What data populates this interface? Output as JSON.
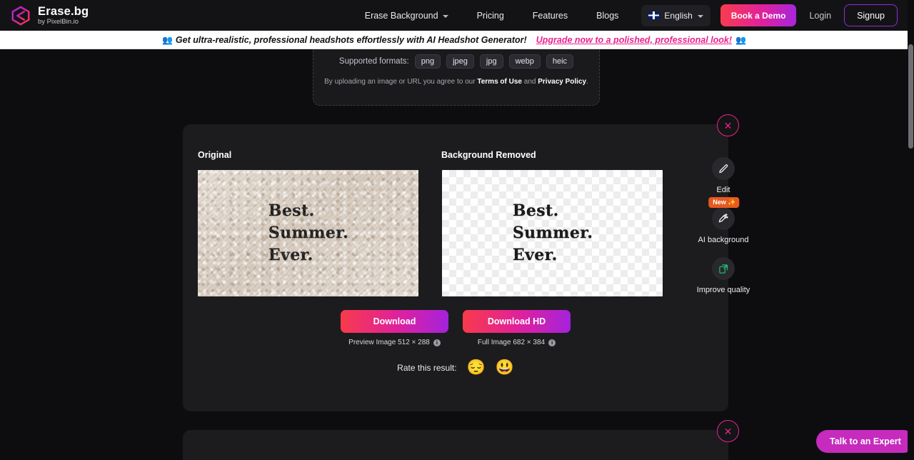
{
  "header": {
    "brand": {
      "name": "Erase.bg",
      "subtitle": "by PixelBin.io",
      "logo_icon": "erasebg-logo-icon"
    },
    "nav": [
      {
        "label": "Erase Background",
        "has_dropdown": true
      },
      {
        "label": "Pricing",
        "has_dropdown": false
      },
      {
        "label": "Features",
        "has_dropdown": false
      },
      {
        "label": "Blogs",
        "has_dropdown": false
      }
    ],
    "language": {
      "label": "English",
      "flag_icon": "uk-flag-icon",
      "chevron_icon": "chevron-down-icon"
    },
    "book_demo_label": "Book a Demo",
    "login_label": "Login",
    "signup_label": "Signup"
  },
  "banner": {
    "emoji_left": "👥",
    "text": "Get ultra-realistic, professional headshots effortlessly with AI Headshot Generator!",
    "link": "Upgrade now to a polished, professional look!",
    "emoji_right": "👥"
  },
  "upload": {
    "formats_label": "Supported formats:",
    "formats": [
      "png",
      "jpeg",
      "jpg",
      "webp",
      "heic"
    ],
    "terms_prefix": "By uploading an image or URL you agree to our ",
    "terms_link": "Terms of Use",
    "terms_middle": " and ",
    "privacy_link": "Privacy Policy",
    "terms_suffix": "."
  },
  "result": {
    "original_title": "Original",
    "removed_title": "Background Removed",
    "poster_text": "Best.\nSummer.\nEver.",
    "tools": [
      {
        "label": "Edit",
        "icon": "pencil-icon",
        "badge": null
      },
      {
        "label": "AI background",
        "icon": "magic-wand-icon",
        "badge": "New ✨"
      },
      {
        "label": "Improve quality",
        "icon": "enhance-image-icon",
        "badge": null
      }
    ],
    "downloads": [
      {
        "label": "Download",
        "meta": "Preview Image 512 × 288"
      },
      {
        "label": "Download HD",
        "meta": "Full Image 682 × 384"
      }
    ],
    "rate_label": "Rate this result:",
    "rate_emojis": [
      "😔",
      "😃"
    ]
  },
  "close_label": "✕",
  "expert_button_label": "Talk to an Expert",
  "colors": {
    "page_bg": "#0d0d0f",
    "card_bg": "#1c1c1f",
    "header_bg": "#131316",
    "accent_pink": "#e8238e",
    "accent_purple": "#8b2fd4",
    "badge_orange": "#e8591f",
    "expert_magenta": "#c62bbe"
  }
}
